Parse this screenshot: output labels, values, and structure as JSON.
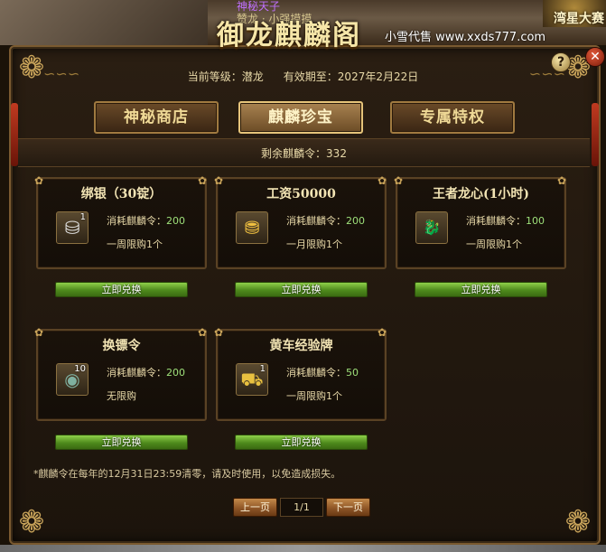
{
  "scene": {
    "player_name": "神秘天子",
    "player_sub": "赞龙 · 小强摸摸",
    "right_badge": "湾星大赛",
    "watermark": "小雪代售 www.xxds777.com"
  },
  "panel": {
    "title": "御龙麒麟阁",
    "help_label": "?",
    "close_label": "✕"
  },
  "info": {
    "level_label": "当前等级：",
    "level_value": "潜龙",
    "expiry_label": "有效期至：",
    "expiry_value": "2027年2月22日"
  },
  "tabs": [
    {
      "label": "神秘商店",
      "active": false
    },
    {
      "label": "麒麟珍宝",
      "active": true
    },
    {
      "label": "专属特权",
      "active": false
    }
  ],
  "remaining": {
    "label": "剩余麒麟令：",
    "value": "332"
  },
  "items": [
    {
      "title": "绑银（30锭）",
      "icon": "silver-ingot-icon",
      "glyph": "⛁",
      "qty": "1",
      "cost_label": "消耗麒麟令：",
      "cost": "200",
      "limit": "一周限购1个",
      "button": "立即兑换"
    },
    {
      "title": "工资50000",
      "icon": "gold-treasure-icon",
      "glyph": "⛃",
      "qty": "",
      "cost_label": "消耗麒麟令：",
      "cost": "200",
      "limit": "一月限购1个",
      "button": "立即兑换"
    },
    {
      "title": "王者龙心(1小时)",
      "icon": "dragon-heart-icon",
      "glyph": "🐉",
      "qty": "",
      "cost_label": "消耗麒麟令：",
      "cost": "100",
      "limit": "一周限购1个",
      "button": "立即兑换"
    },
    {
      "title": "换镖令",
      "icon": "escort-token-icon",
      "glyph": "◉",
      "qty": "10",
      "cost_label": "消耗麒麟令：",
      "cost": "200",
      "limit": "无限购",
      "button": "立即兑换"
    },
    {
      "title": "黄车经验牌",
      "icon": "yellow-cart-card-icon",
      "glyph": "⛟",
      "qty": "1",
      "cost_label": "消耗麒麟令：",
      "cost": "50",
      "limit": "一周限购1个",
      "button": "立即兑换"
    }
  ],
  "footnote": "*麒麟令在每年的12月31日23:59清零，请及时使用，以免造成损失。",
  "pager": {
    "prev": "上一页",
    "page": "1/1",
    "next": "下一页"
  }
}
